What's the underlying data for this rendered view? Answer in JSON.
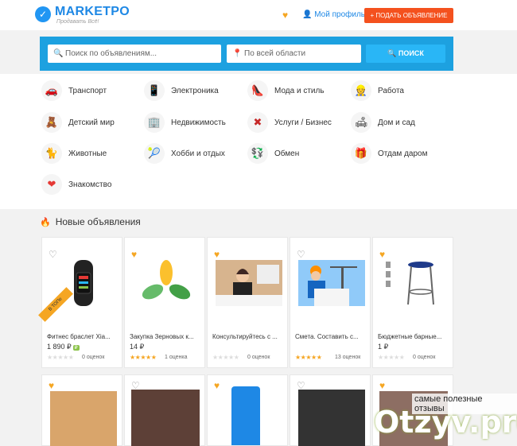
{
  "header": {
    "logo_title": "MARKETPO",
    "logo_sub": "Продавать Всё!",
    "profile_label": "Мой профиль",
    "post_button": "+ ПОДАТЬ ОБЪЯВЛЕНИЕ"
  },
  "search": {
    "query_placeholder": "Поиск по объявлениям...",
    "location_value": "По всей области",
    "button_label": "ПОИСК"
  },
  "categories": [
    {
      "label": "Транспорт",
      "icon": "car-icon"
    },
    {
      "label": "Электроника",
      "icon": "phone-icon"
    },
    {
      "label": "Мода и стиль",
      "icon": "shoe-icon"
    },
    {
      "label": "Работа",
      "icon": "worker-icon"
    },
    {
      "label": "Детский мир",
      "icon": "teddy-bear-icon"
    },
    {
      "label": "Недвижимость",
      "icon": "building-icon"
    },
    {
      "label": "Услуги / Бизнес",
      "icon": "tools-icon"
    },
    {
      "label": "Дом и сад",
      "icon": "sofa-icon"
    },
    {
      "label": "Животные",
      "icon": "cat-icon"
    },
    {
      "label": "Хобби и отдых",
      "icon": "racket-icon"
    },
    {
      "label": "Обмен",
      "icon": "exchange-icon"
    },
    {
      "label": "Отдам даром",
      "icon": "gift-icon"
    },
    {
      "label": "Знакомство",
      "icon": "heart-pulse-icon"
    }
  ],
  "section_title": "Новые объявления",
  "listings": [
    {
      "title": "Фитнес браслет Xia...",
      "price": "1 890 ₽",
      "rating": 0,
      "reviews": "0 оценок",
      "favorite": false,
      "top": true,
      "badge": "₽"
    },
    {
      "title": "Закупка Зерновых к...",
      "price": "14 ₽",
      "rating": 5,
      "reviews": "1 оценка",
      "favorite": true,
      "top": false
    },
    {
      "title": "Консультируйтесь с ...",
      "price": "",
      "rating": 0,
      "reviews": "0 оценок",
      "favorite": true,
      "top": false
    },
    {
      "title": "Смета. Составить с...",
      "price": "",
      "rating": 5,
      "reviews": "13 оценок",
      "favorite": false,
      "top": false
    },
    {
      "title": "Бюджетные барные...",
      "price": "1 ₽",
      "rating": 0,
      "reviews": "0 оценок",
      "favorite": true,
      "top": false
    }
  ],
  "top_badge": "В ТОПе",
  "watermark": {
    "text": "самые полезные отзывы",
    "logo": "Otzyv.pro"
  },
  "colors": {
    "brand": "#1e88e5",
    "search_bg": "#1da1e0",
    "accent": "#f4511e",
    "star": "#f5a623"
  }
}
